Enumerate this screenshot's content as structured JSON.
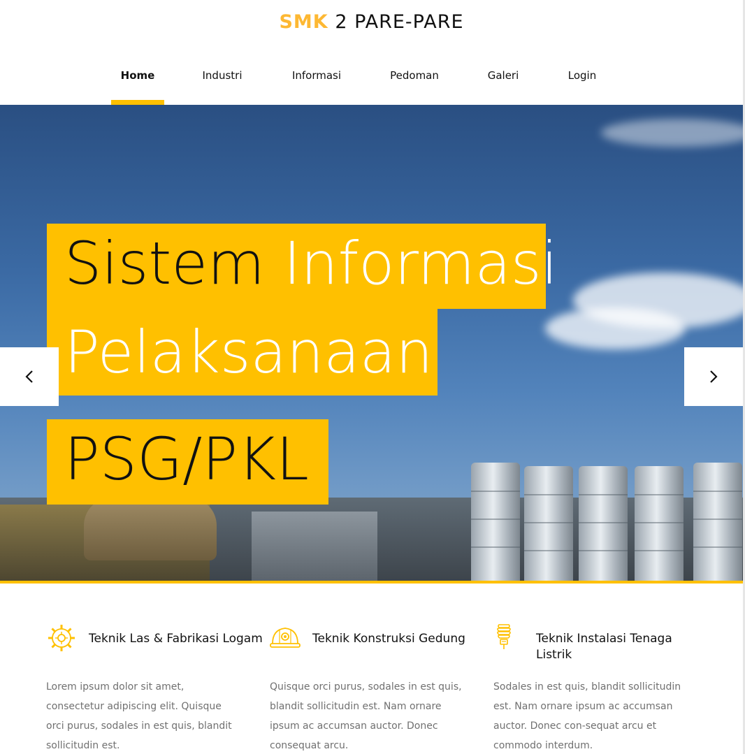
{
  "brand": {
    "accent": "SMK",
    "rest": " 2 PARE-PARE"
  },
  "nav": {
    "items": [
      {
        "label": "Home",
        "active": true
      },
      {
        "label": "Industri"
      },
      {
        "label": "Informasi"
      },
      {
        "label": "Pedoman"
      },
      {
        "label": "Galeri"
      },
      {
        "label": "Login"
      }
    ]
  },
  "hero": {
    "line1_dark": "Sistem",
    "line1_light": "Informasi",
    "line2": "Pelaksanaan",
    "line3": "PSG/PKL",
    "prev_icon": "chevron-left-icon",
    "next_icon": "chevron-right-icon"
  },
  "features": [
    {
      "icon": "gear-icon",
      "title": "Teknik Las & Fabrikasi Logam",
      "text": "Lorem ipsum dolor sit amet, consectetur adipiscing elit. Quisque orci purus, sodales in est quis, blandit sollicitudin est."
    },
    {
      "icon": "hard-hat-icon",
      "title": "Teknik Konstruksi Gedung",
      "text": "Quisque orci purus, sodales in est quis, blandit sollicitudin est. Nam ornare ipsum ac accumsan auctor. Donec consequat arcu."
    },
    {
      "icon": "light-bulb-icon",
      "title": "Teknik Instalasi Tenaga Listrik",
      "text": "Sodales in est quis, blandit sollicitudin est. Nam ornare ipsum ac accumsan auctor. Donec con-sequat arcu et commodo interdum."
    }
  ],
  "colors": {
    "accent": "#ffc000",
    "brand_accent": "#fdb833",
    "muted_text": "#707070"
  }
}
